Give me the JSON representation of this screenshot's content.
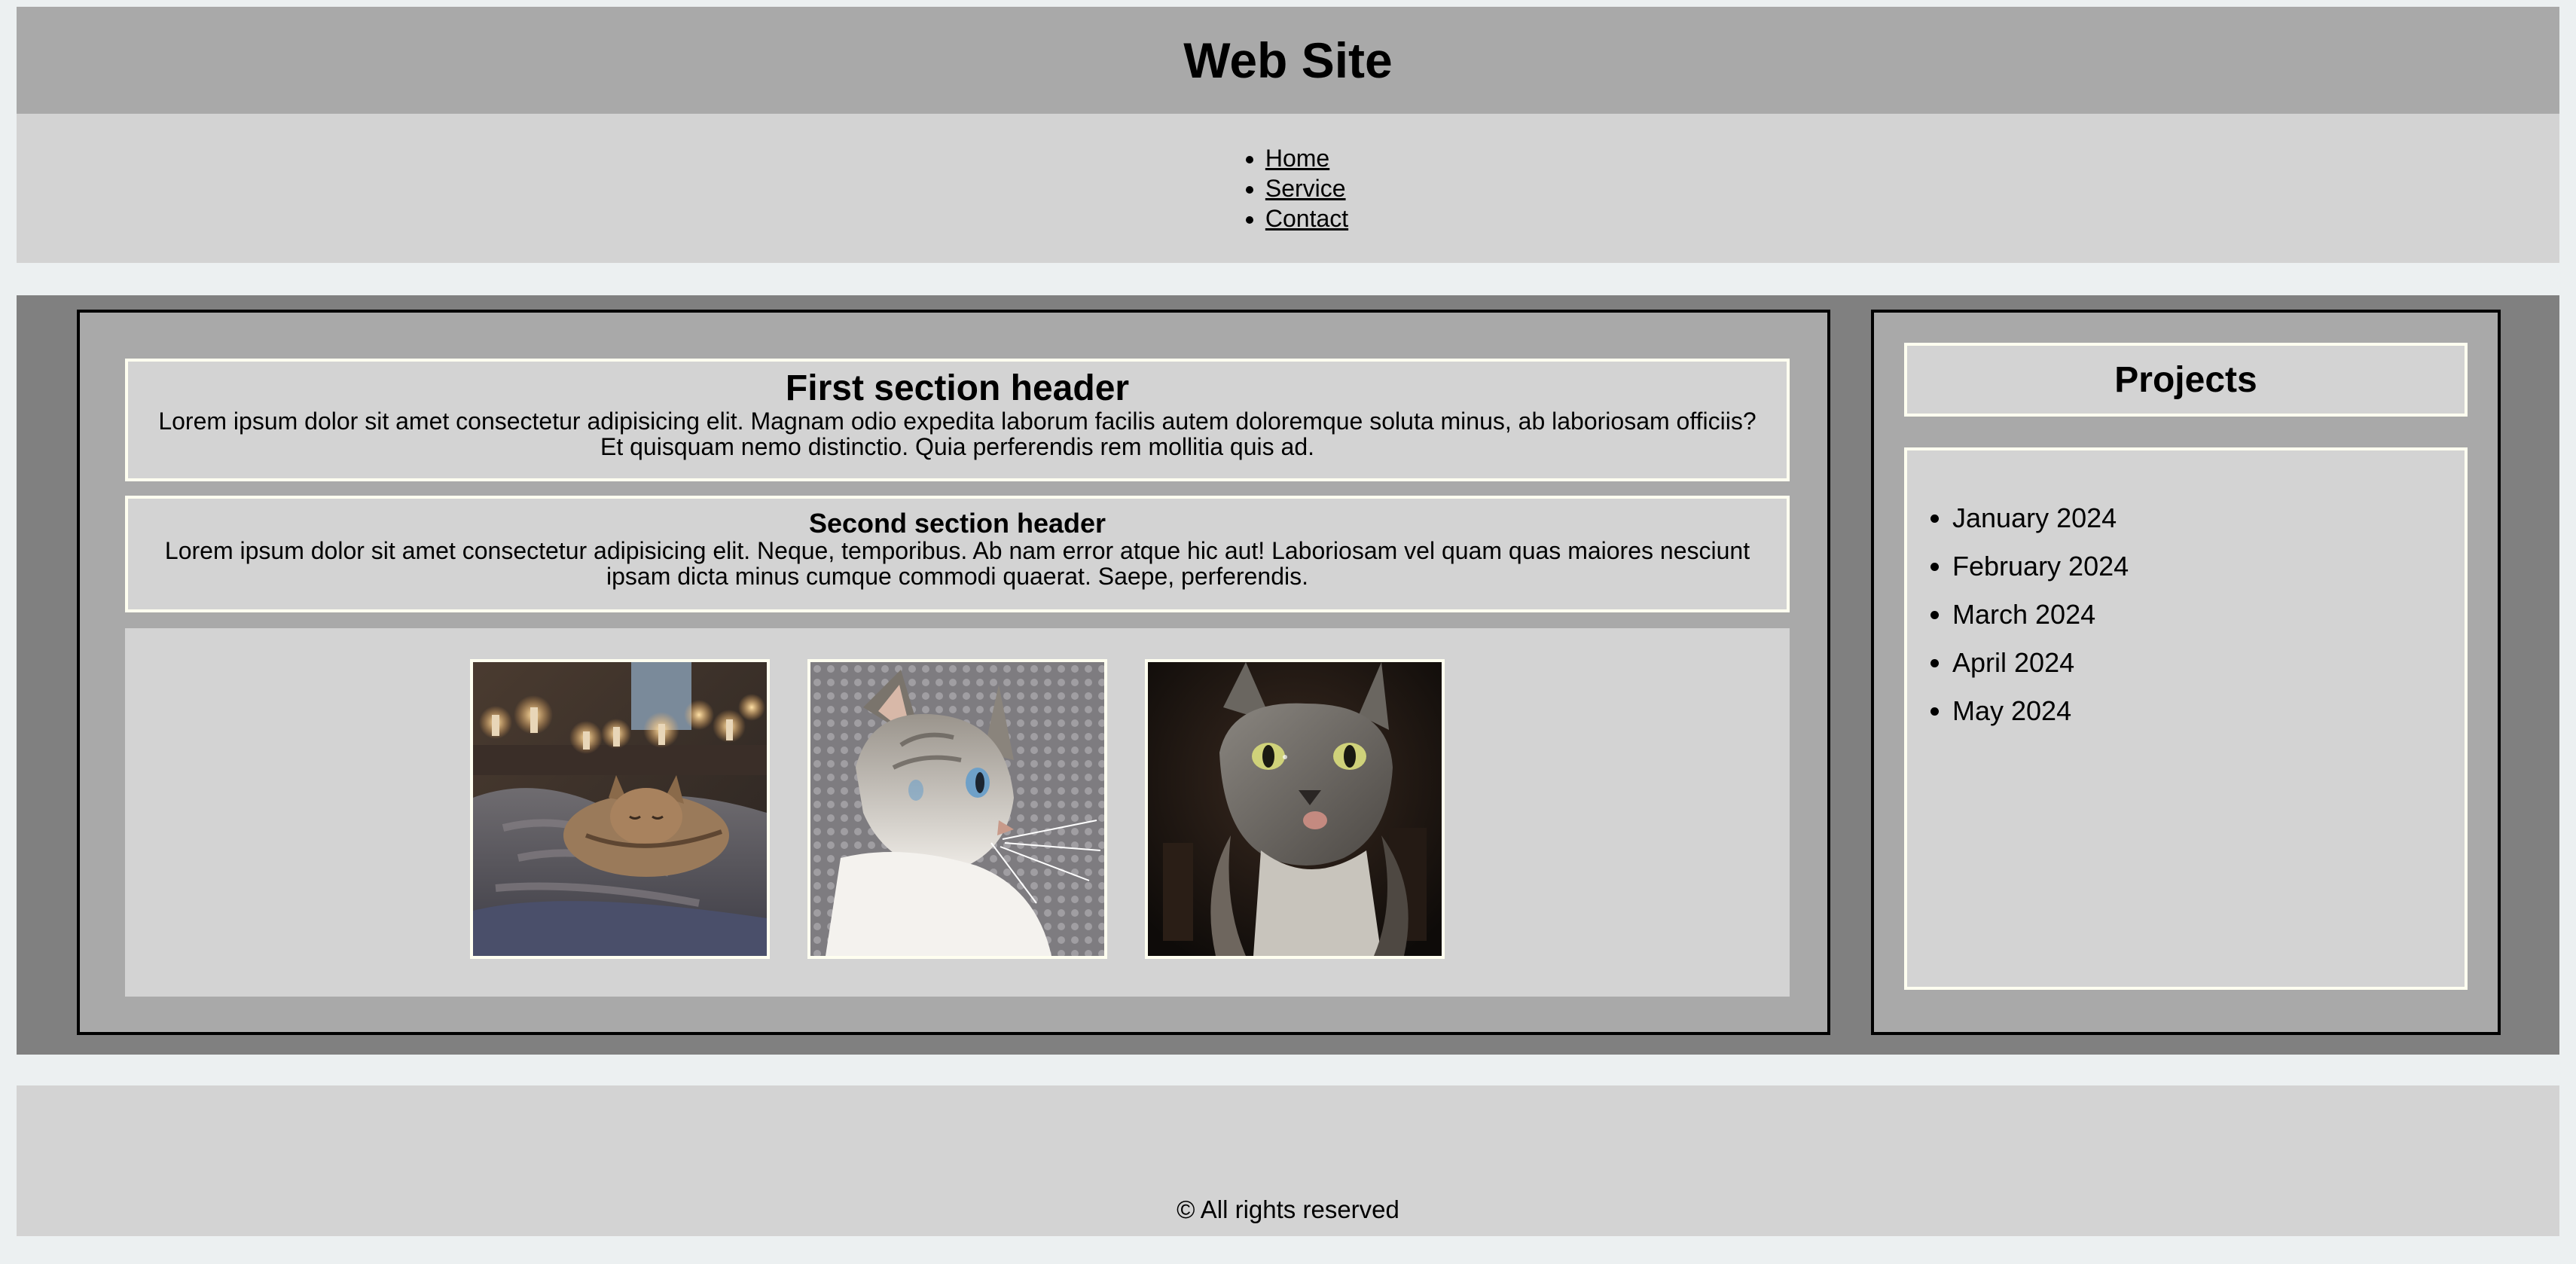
{
  "header": {
    "title": "Web Site"
  },
  "nav": {
    "items": [
      {
        "label": "Home"
      },
      {
        "label": "Service"
      },
      {
        "label": "Contact"
      }
    ]
  },
  "main": {
    "sections": [
      {
        "title": "First section header",
        "body": "Lorem ipsum dolor sit amet consectetur adipisicing elit. Magnam odio expedita laborum facilis autem doloremque soluta minus, ab laboriosam officiis? Et quisquam nemo distinctio. Quia perferendis rem mollitia quis ad."
      },
      {
        "title": "Second section header",
        "body": "Lorem ipsum dolor sit amet consectetur adipisicing elit. Neque, temporibus. Ab nam error atque hic aut! Laboriosam vel quam quas maiores nesciunt ipsam dicta minus cumque commodi quaerat. Saepe, perferendis."
      }
    ],
    "gallery": [
      {
        "subject": "sleeping-cat-with-candles"
      },
      {
        "subject": "white-grey-cat-portrait"
      },
      {
        "subject": "grey-cat-dark-background"
      }
    ]
  },
  "sidebar": {
    "title": "Projects",
    "items": [
      {
        "label": "January 2024"
      },
      {
        "label": "February 2024"
      },
      {
        "label": "March 2024"
      },
      {
        "label": "April 2024"
      },
      {
        "label": "May 2024"
      }
    ]
  },
  "footer": {
    "text": "© All rights reserved"
  },
  "colors": {
    "page_bg": "#ecf0f1",
    "header_bg": "#a9a9a9",
    "nav_bg": "#d3d3d3",
    "main_bg": "#808080",
    "panel_bg": "#a9a9a9",
    "card_bg": "#d3d3d3",
    "card_border": "#fffff0"
  }
}
